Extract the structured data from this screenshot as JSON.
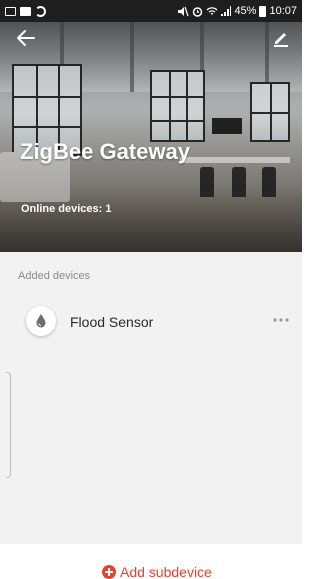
{
  "status_bar": {
    "battery": "45%",
    "time": "10:07"
  },
  "header": {
    "title": "ZigBee Gateway",
    "online_devices": "Online devices: 1",
    "back_icon": "arrow-left-icon",
    "edit_icon": "pencil-icon"
  },
  "devices": {
    "section_label": "Added devices",
    "items": [
      {
        "name": "Flood Sensor",
        "icon": "water-drop-icon",
        "more_icon": "more-horizontal-icon"
      }
    ]
  },
  "footer": {
    "add_label": "Add subdevice",
    "accent_color": "#e4432d"
  }
}
